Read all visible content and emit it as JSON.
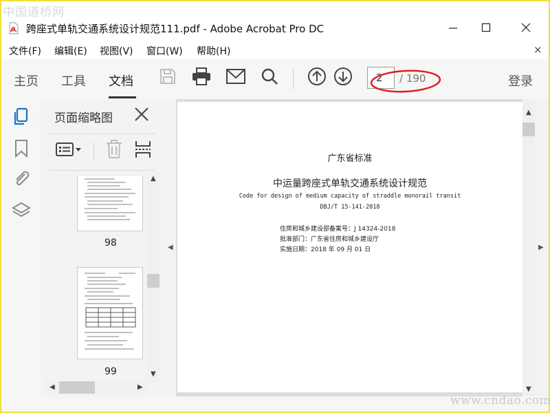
{
  "watermark_top": "中国道桥网",
  "watermark_bottom": "www.cndao.com",
  "window": {
    "title": "跨座式单轨交通系统设计规范111.pdf - Adobe Acrobat Pro DC"
  },
  "menu": {
    "items": [
      {
        "label": "文件(F)"
      },
      {
        "label": "编辑(E)"
      },
      {
        "label": "视图(V)"
      },
      {
        "label": "窗口(W)"
      },
      {
        "label": "帮助(H)"
      }
    ],
    "close_symbol": "×"
  },
  "toolbar": {
    "tabs": [
      {
        "label": "主页"
      },
      {
        "label": "工具"
      },
      {
        "label": "文档"
      }
    ],
    "active_tab": "文档",
    "page_current": "2",
    "page_total": "/ 190",
    "login": "登录",
    "highlight_color": "#e02020"
  },
  "thumbnails_panel": {
    "title": "页面缩略图",
    "pages": [
      {
        "number": "98"
      },
      {
        "number": "99"
      }
    ]
  },
  "document": {
    "header": "广东省标准",
    "title_cn": "中运量跨座式单轨交通系统设计规范",
    "title_en": "Code for design of medium capacity of straddle monorail transit",
    "code": "DBJ/T 15-141-2018",
    "meta": [
      {
        "text": "住房和城乡建设部备案号：J 14324-2018"
      },
      {
        "text": "批准部门：广东省住房和城乡建设厅"
      },
      {
        "text": "实施日期：2018 年 09 月 01 日"
      }
    ]
  },
  "colors": {
    "frame": "#f2df3a",
    "accent": "#1a73c9",
    "pdf_icon": "#d32f2f"
  }
}
